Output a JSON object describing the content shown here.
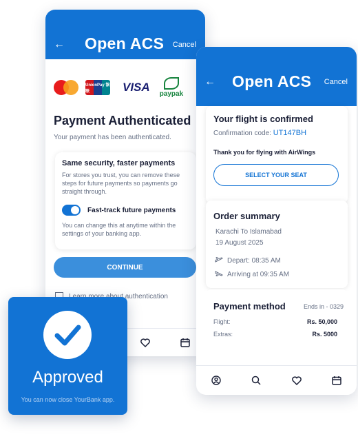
{
  "left_screen": {
    "header": {
      "back_icon": "arrow-left-icon",
      "title": "Open ACS",
      "cancel": "Cancel"
    },
    "card_brands": [
      "mastercard",
      "UnionPay 银联",
      "VISA",
      "paypak"
    ],
    "auth_title": "Payment Authenticated",
    "auth_subtitle": "Your payment has been authenticated.",
    "security": {
      "title": "Same security, faster payments",
      "text": "For stores you trust, you can remove these steps for future payments so payments go straight through.",
      "toggle_label": "Fast-track future payments",
      "toggle_on": true,
      "note": "You can change this at anytime within the settings of your banking app."
    },
    "continue_label": "CONTINUE",
    "learn_more": "Learn more about authentication"
  },
  "right_screen": {
    "header": {
      "back_icon": "arrow-left-icon",
      "title": "Open ACS",
      "cancel": "Cancel"
    },
    "flight": {
      "title": "Your flight is confirmed",
      "confirmation_label": "Confirmation code:",
      "confirmation_code": "UT147BH",
      "thanks": "Thank you for flying with AirWings",
      "seat_button": "SELECT YOUR SEAT"
    },
    "order": {
      "title": "Order summary",
      "route": "Karachi To Islamabad",
      "date": "19 August 2025",
      "depart": "Depart: 08:35 AM",
      "arrive": "Arriving at 09:35 AM"
    },
    "payment": {
      "title": "Payment method",
      "ends_in": "Ends in - 0329",
      "flight_label": "Flight:",
      "flight_value": "Rs. 50,000",
      "extras_label": "Extras:",
      "extras_value": "Rs. 5000"
    }
  },
  "approved": {
    "title": "Approved",
    "note": "You can now close YourBank app."
  },
  "colors": {
    "primary": "#1273d4",
    "text": "#1a1f36",
    "muted": "#667085"
  }
}
